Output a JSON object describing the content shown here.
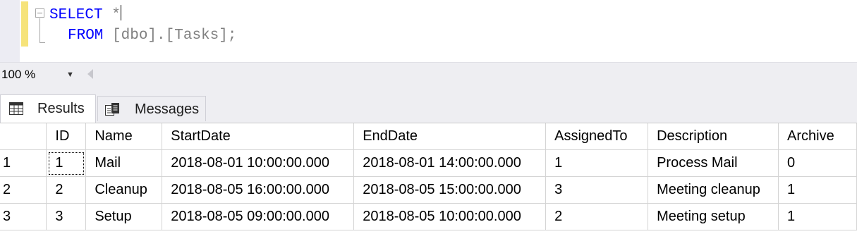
{
  "editor": {
    "line1_keyword": "SELECT",
    "line1_rest": " *",
    "line2_keyword": "FROM",
    "line2_rest": " [dbo].[Tasks];"
  },
  "zoom": {
    "value": "100 %"
  },
  "tabs": [
    {
      "label": "Results",
      "icon": "grid-icon"
    },
    {
      "label": "Messages",
      "icon": "messages-icon"
    }
  ],
  "results": {
    "columns": [
      "ID",
      "Name",
      "StartDate",
      "EndDate",
      "AssignedTo",
      "Description",
      "Archive"
    ],
    "rows": [
      {
        "num": "1",
        "cells": [
          "1",
          "Mail",
          "2018-08-01 10:00:00.000",
          "2018-08-01 14:00:00.000",
          "1",
          "Process Mail",
          "0"
        ]
      },
      {
        "num": "2",
        "cells": [
          "2",
          "Cleanup",
          "2018-08-05 16:00:00.000",
          "2018-08-05 15:00:00.000",
          "3",
          "Meeting cleanup",
          "1"
        ]
      },
      {
        "num": "3",
        "cells": [
          "3",
          "Setup",
          "2018-08-05 09:00:00.000",
          "2018-08-05 10:00:00.000",
          "2",
          "Meeting setup",
          "1"
        ]
      }
    ]
  },
  "colors": {
    "keyword": "#0000ff",
    "change_bar": "#f6e37a",
    "chrome": "#eeeef2"
  }
}
